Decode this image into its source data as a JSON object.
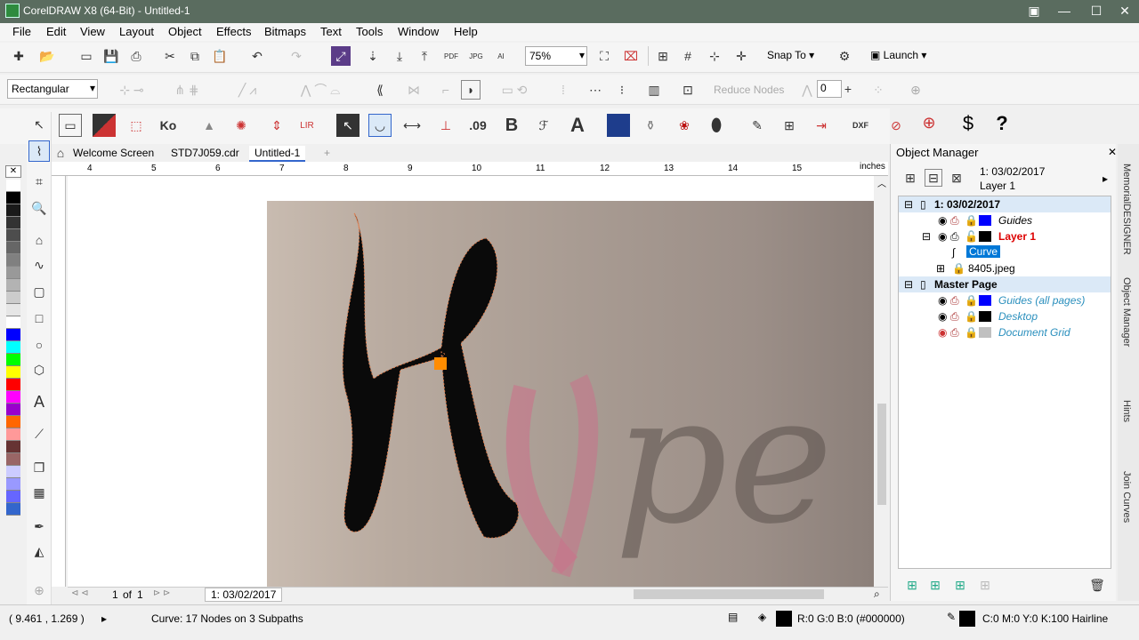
{
  "window": {
    "title": "CorelDRAW X8 (64-Bit) - Untitled-1"
  },
  "menu": [
    "File",
    "Edit",
    "View",
    "Layout",
    "Object",
    "Effects",
    "Bitmaps",
    "Text",
    "Tools",
    "Window",
    "Help"
  ],
  "standard_toolbar": {
    "zoom": "75%",
    "snap_to": "Snap To",
    "launch": "Launch",
    "pdf_label": "PDF",
    "jpg_label": "JPG",
    "ai_label": "AI"
  },
  "property_bar": {
    "shape_mode": "Rectangular",
    "reduce_nodes": "Reduce Nodes",
    "nodes_value": "0"
  },
  "extra_toolbar": {
    "dollar": "$",
    "help": "?",
    "bold": "B",
    "text_a": "A",
    "n09": ".09",
    "dxf": "DXF"
  },
  "doc_tabs": [
    "Welcome Screen",
    "STD7J059.cdr",
    "Untitled-1"
  ],
  "ruler": {
    "units": "inches",
    "labels": [
      "4",
      "5",
      "6",
      "7",
      "8",
      "9",
      "10",
      "11",
      "12",
      "13",
      "14",
      "15"
    ]
  },
  "page_nav": {
    "current": "1",
    "of_label": "of",
    "total": "1",
    "page_tab": "1: 03/02/2017"
  },
  "status": {
    "coords": "( 9.461 , 1.269 )",
    "info": "Curve: 17 Nodes on 3 Subpaths",
    "fill_label": "R:0 G:0 B:0 (#000000)",
    "outline_label": "C:0 M:0 Y:0 K:100  Hairline"
  },
  "object_manager": {
    "title": "Object Manager",
    "header_page": "1: 03/02/2017",
    "header_layer": "Layer 1",
    "rows": [
      {
        "label": "1: 03/02/2017",
        "kind": "page",
        "color": ""
      },
      {
        "label": "Guides",
        "kind": "layer",
        "color": "#0000ff"
      },
      {
        "label": "Layer 1",
        "kind": "layer-active",
        "color": "#000000"
      },
      {
        "label": "Curve",
        "kind": "object-selected",
        "color": ""
      },
      {
        "label": "8405.jpeg",
        "kind": "object",
        "color": ""
      },
      {
        "label": "Master Page",
        "kind": "page",
        "color": ""
      },
      {
        "label": "Guides (all pages)",
        "kind": "master-layer",
        "color": "#0000ff"
      },
      {
        "label": "Desktop",
        "kind": "master-layer",
        "color": "#000000"
      },
      {
        "label": "Document Grid",
        "kind": "master-layer",
        "color": "#c0c0c0"
      }
    ]
  },
  "side_tabs": [
    "MemorialDESIGNER",
    "Object Manager",
    "Hints",
    "Join Curves"
  ],
  "palette": [
    "#ffffff",
    "#000000",
    "#1a1a1a",
    "#333333",
    "#4d4d4d",
    "#666666",
    "#808080",
    "#999999",
    "#b3b3b3",
    "#cccccc",
    "#e6e6e6",
    "#ffffff",
    "#0000ff",
    "#00ffff",
    "#00ff00",
    "#ffff00",
    "#ff0000",
    "#ff00ff",
    "#9900cc",
    "#ff6600",
    "#ff9999",
    "#663333",
    "#996666",
    "#ccccff",
    "#9999ff",
    "#6666ff",
    "#3366cc"
  ]
}
